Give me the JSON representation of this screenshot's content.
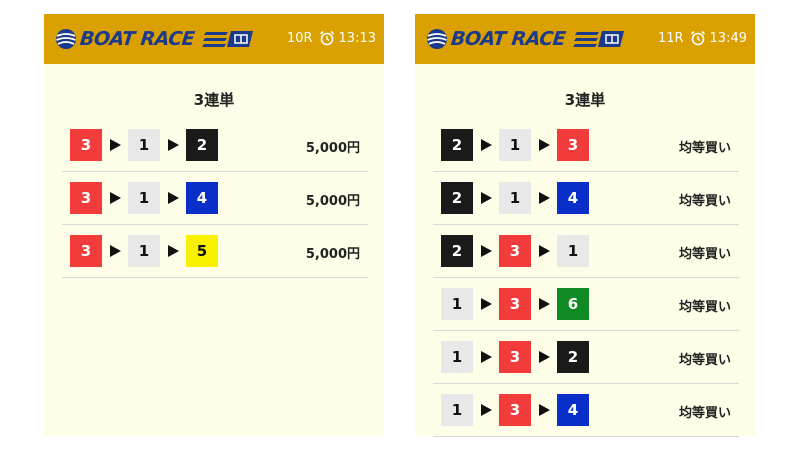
{
  "brand": {
    "logo_text": "BOAT RACE"
  },
  "cards": [
    {
      "race": "10R",
      "time": "13:13",
      "ticket_type": "3連単",
      "rows": [
        {
          "boats": [
            3,
            1,
            2
          ],
          "amount": "5,000円"
        },
        {
          "boats": [
            3,
            1,
            4
          ],
          "amount": "5,000円"
        },
        {
          "boats": [
            3,
            1,
            5
          ],
          "amount": "5,000円"
        }
      ]
    },
    {
      "race": "11R",
      "time": "13:49",
      "ticket_type": "3連単",
      "rows": [
        {
          "boats": [
            2,
            1,
            3
          ],
          "amount": "均等買い"
        },
        {
          "boats": [
            2,
            1,
            4
          ],
          "amount": "均等買い"
        },
        {
          "boats": [
            2,
            3,
            1
          ],
          "amount": "均等買い"
        },
        {
          "boats": [
            1,
            3,
            6
          ],
          "amount": "均等買い"
        },
        {
          "boats": [
            1,
            3,
            2
          ],
          "amount": "均等買い"
        },
        {
          "boats": [
            1,
            3,
            4
          ],
          "amount": "均等買い"
        }
      ]
    }
  ],
  "colors": {
    "header": "#d9a000",
    "card_bg": "#fefee8",
    "boat_1": "#e8e8e8",
    "boat_2": "#1a1a1a",
    "boat_3": "#f23c3c",
    "boat_4": "#0a2ec8",
    "boat_5": "#f8f200",
    "boat_6": "#0f8a24"
  }
}
